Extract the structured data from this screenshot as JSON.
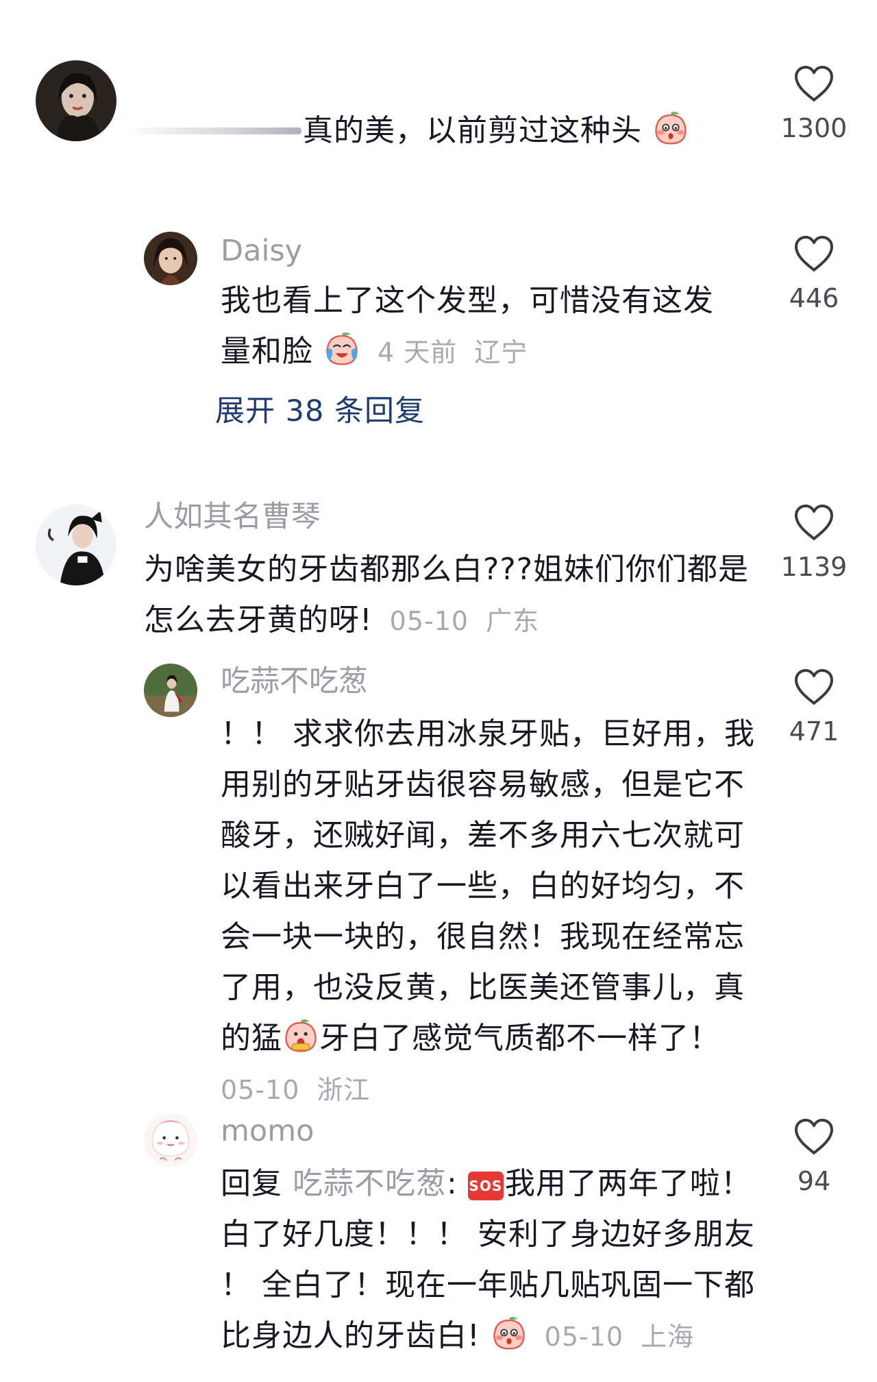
{
  "comments": [
    {
      "text_lines": [
        "真的美，以前剪过这种头"
      ],
      "emoji": "blushing-peach-emoji",
      "likes": "1300"
    },
    {
      "username": "Daisy",
      "text_lines": [
        "我也看上了这个发型，可惜没有这发",
        "量和脸"
      ],
      "emoji": "crying-laughing-peach-emoji",
      "time": "4 天前",
      "location": "辽宁",
      "likes": "446",
      "expand_label": "展开 38 条回复"
    },
    {
      "username": "人如其名曹琴",
      "text_lines": [
        "为啥美女的牙齿都那么白???姐妹们你们都是",
        "怎么去牙黄的呀!"
      ],
      "time": "05-10",
      "location": "广东",
      "likes": "1139"
    },
    {
      "username": "吃蒜不吃葱",
      "text_lines": [
        "！！ 求求你去用冰泉牙贴，巨好用，我",
        "用别的牙贴牙齿很容易敏感，但是它不",
        "酸牙，还贼好闻，差不多用六七次就可",
        "以看出来牙白了一些，白的好均匀，不",
        "会一块一块的，很自然！我现在经常忘",
        "了用，也没反黄，比医美还管事儿，真",
        "的猛",
        "牙白了感觉气质都不一样了！"
      ],
      "emoji": "shocked-peach-emoji",
      "time": "05-10",
      "location": "浙江",
      "likes": "471"
    },
    {
      "username": "momo",
      "reply_prefix": "回复",
      "reply_to": "吃蒜不吃葱",
      "reply_colon": ":",
      "sos_label": "SOS",
      "text_lines": [
        "我用了两年了啦！",
        "白了好几度！！！ 安利了身边好多朋友",
        "！ 全白了！现在一年贴几贴巩固一下都",
        "比身边人的牙齿白!"
      ],
      "emoji": "blushing-peach-emoji",
      "time": "05-10",
      "location": "上海",
      "likes": "94"
    }
  ],
  "colors": {
    "text": "#161823",
    "username": "#9c9ca4",
    "meta": "#a8a8b0",
    "expand_link": "#1e3c72",
    "like_count": "#4a4a52",
    "sos_badge": "#e53935"
  }
}
